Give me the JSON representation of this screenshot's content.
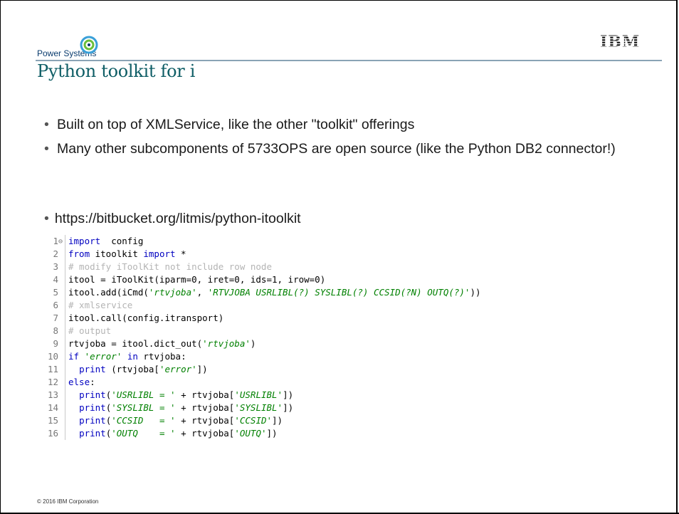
{
  "header": {
    "brand": "Power Systems",
    "logo": "IBM",
    "title": "Python toolkit for i"
  },
  "bullets": [
    "Built on top of XMLService, like the other \"toolkit\" offerings",
    "Many other subcomponents of 5733OPS are open source (like the Python DB2 connector!)"
  ],
  "link_bullet": "https://bitbucket.org/litmis/python-itoolkit",
  "code": [
    {
      "n": "1",
      "parts": [
        [
          "kw",
          "import"
        ],
        [
          "",
          "  config"
        ]
      ]
    },
    {
      "n": "2",
      "parts": [
        [
          "kw",
          "from"
        ],
        [
          "",
          " itoolkit "
        ],
        [
          "kw",
          "import"
        ],
        [
          "",
          " *"
        ]
      ]
    },
    {
      "n": "3",
      "parts": [
        [
          "cm",
          "# modify iToolKit not include row node"
        ]
      ]
    },
    {
      "n": "4",
      "parts": [
        [
          "",
          "itool = iToolKit(iparm=0, iret=0, ids=1, irow=0)"
        ]
      ]
    },
    {
      "n": "5",
      "parts": [
        [
          "",
          "itool.add(iCmd("
        ],
        [
          "st",
          "'rtvjoba'"
        ],
        [
          "",
          ", "
        ],
        [
          "st",
          "'RTVJOBA USRLIBL(?) SYSLIBL(?) CCSID(?N) OUTQ(?)'"
        ],
        [
          "",
          "))"
        ]
      ]
    },
    {
      "n": "6",
      "parts": [
        [
          "cm",
          "# xmlservice"
        ]
      ]
    },
    {
      "n": "7",
      "parts": [
        [
          "",
          "itool.call(config.itransport)"
        ]
      ]
    },
    {
      "n": "8",
      "parts": [
        [
          "cm",
          "# output"
        ]
      ]
    },
    {
      "n": "9",
      "parts": [
        [
          "",
          "rtvjoba = itool.dict_out("
        ],
        [
          "st",
          "'rtvjoba'"
        ],
        [
          "",
          ")"
        ]
      ]
    },
    {
      "n": "10",
      "parts": [
        [
          "kw",
          "if"
        ],
        [
          "",
          " "
        ],
        [
          "st",
          "'error'"
        ],
        [
          "",
          " "
        ],
        [
          "kw",
          "in"
        ],
        [
          "",
          " rtvjoba:"
        ]
      ]
    },
    {
      "n": "11",
      "parts": [
        [
          "",
          "  "
        ],
        [
          "kw",
          "print"
        ],
        [
          "",
          " (rtvjoba["
        ],
        [
          "st",
          "'error'"
        ],
        [
          "",
          "])"
        ]
      ]
    },
    {
      "n": "12",
      "parts": [
        [
          "kw",
          "else"
        ],
        [
          "",
          ":"
        ]
      ]
    },
    {
      "n": "13",
      "parts": [
        [
          "",
          "  "
        ],
        [
          "kw",
          "print"
        ],
        [
          "",
          "("
        ],
        [
          "st",
          "'USRLIBL = '"
        ],
        [
          "",
          " + rtvjoba["
        ],
        [
          "st",
          "'USRLIBL'"
        ],
        [
          "",
          "])"
        ]
      ]
    },
    {
      "n": "14",
      "parts": [
        [
          "",
          "  "
        ],
        [
          "kw",
          "print"
        ],
        [
          "",
          "("
        ],
        [
          "st",
          "'SYSLIBL = '"
        ],
        [
          "",
          " + rtvjoba["
        ],
        [
          "st",
          "'SYSLIBL'"
        ],
        [
          "",
          "])"
        ]
      ]
    },
    {
      "n": "15",
      "parts": [
        [
          "",
          "  "
        ],
        [
          "kw",
          "print"
        ],
        [
          "",
          "("
        ],
        [
          "st",
          "'CCSID   = '"
        ],
        [
          "",
          " + rtvjoba["
        ],
        [
          "st",
          "'CCSID'"
        ],
        [
          "",
          "])"
        ]
      ]
    },
    {
      "n": "16",
      "parts": [
        [
          "",
          "  "
        ],
        [
          "kw",
          "print"
        ],
        [
          "",
          "("
        ],
        [
          "st",
          "'OUTQ    = '"
        ],
        [
          "",
          " + rtvjoba["
        ],
        [
          "st",
          "'OUTQ'"
        ],
        [
          "",
          "])"
        ]
      ]
    }
  ],
  "footer": "© 2016 IBM Corporation"
}
